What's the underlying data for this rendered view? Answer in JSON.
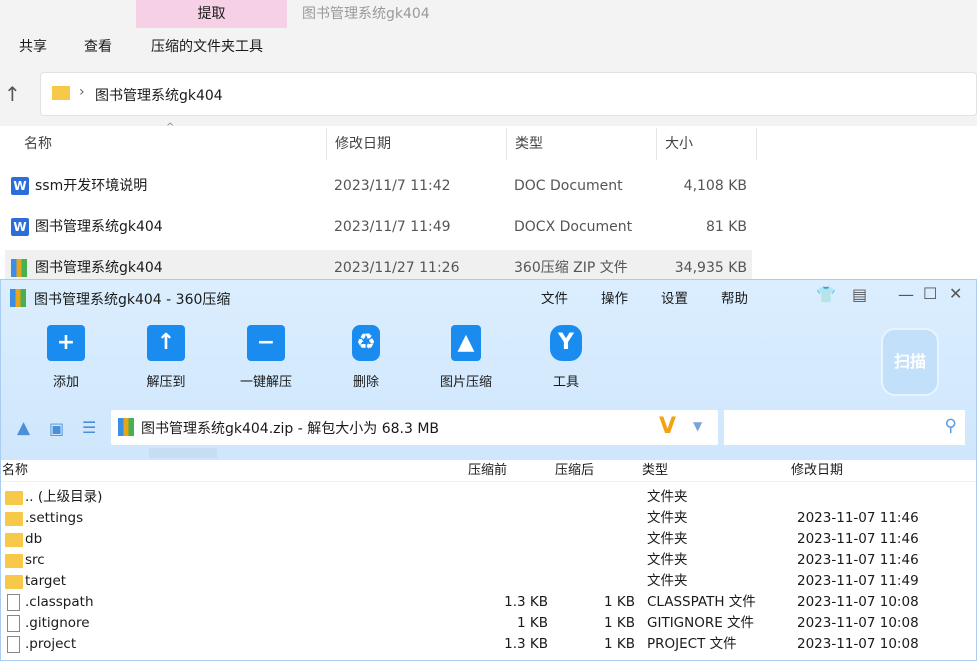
{
  "explorer": {
    "ribbon_tab": "提取",
    "window_title": "图书管理系统gk404",
    "menu": [
      "共享",
      "查看",
      "压缩的文件夹工具"
    ],
    "path": "图书管理系统gk404",
    "columns": [
      "名称",
      "修改日期",
      "类型",
      "大小"
    ],
    "files": [
      {
        "name": "ssm开发环境说明",
        "date": "2023/11/7 11:42",
        "type": "DOC Document",
        "size": "4,108 KB",
        "icon": "word-icon"
      },
      {
        "name": "图书管理系统gk404",
        "date": "2023/11/7 11:49",
        "type": "DOCX Document",
        "size": "81 KB",
        "icon": "word-icon"
      },
      {
        "name": "图书管理系统gk404",
        "date": "2023/11/27 11:26",
        "type": "360压缩 ZIP 文件",
        "size": "34,935 KB",
        "icon": "zip-icon"
      }
    ]
  },
  "zip": {
    "title": "图书管理系统gk404 - 360压缩",
    "menu": [
      "文件",
      "操作",
      "设置",
      "帮助"
    ],
    "toolbar": [
      {
        "label": "添加",
        "glyph": "+"
      },
      {
        "label": "解压到",
        "glyph": "↑"
      },
      {
        "label": "一键解压",
        "glyph": "−"
      },
      {
        "label": "删除",
        "glyph": "♻"
      },
      {
        "label": "图片压缩",
        "glyph": "▲"
      },
      {
        "label": "工具",
        "glyph": "Y"
      }
    ],
    "scan_label": "扫描",
    "path_text": "图书管理系统gk404.zip - 解包大小为 68.3 MB",
    "columns": [
      "名称",
      "压缩前",
      "压缩后",
      "类型",
      "修改日期"
    ],
    "rows": [
      {
        "name": ".. (上级目录)",
        "before": "",
        "after": "",
        "type": "文件夹",
        "date": "",
        "folder": true
      },
      {
        "name": ".settings",
        "before": "",
        "after": "",
        "type": "文件夹",
        "date": "2023-11-07 11:46",
        "folder": true
      },
      {
        "name": "db",
        "before": "",
        "after": "",
        "type": "文件夹",
        "date": "2023-11-07 11:46",
        "folder": true
      },
      {
        "name": "src",
        "before": "",
        "after": "",
        "type": "文件夹",
        "date": "2023-11-07 11:46",
        "folder": true
      },
      {
        "name": "target",
        "before": "",
        "after": "",
        "type": "文件夹",
        "date": "2023-11-07 11:49",
        "folder": true
      },
      {
        "name": ".classpath",
        "before": "1.3 KB",
        "after": "1 KB",
        "type": "CLASSPATH 文件",
        "date": "2023-11-07 10:08",
        "folder": false
      },
      {
        "name": ".gitignore",
        "before": "1 KB",
        "after": "1 KB",
        "type": "GITIGNORE 文件",
        "date": "2023-11-07 10:08",
        "folder": false
      },
      {
        "name": ".project",
        "before": "1.3 KB",
        "after": "1 KB",
        "type": "PROJECT 文件",
        "date": "2023-11-07 10:08",
        "folder": false
      }
    ]
  }
}
